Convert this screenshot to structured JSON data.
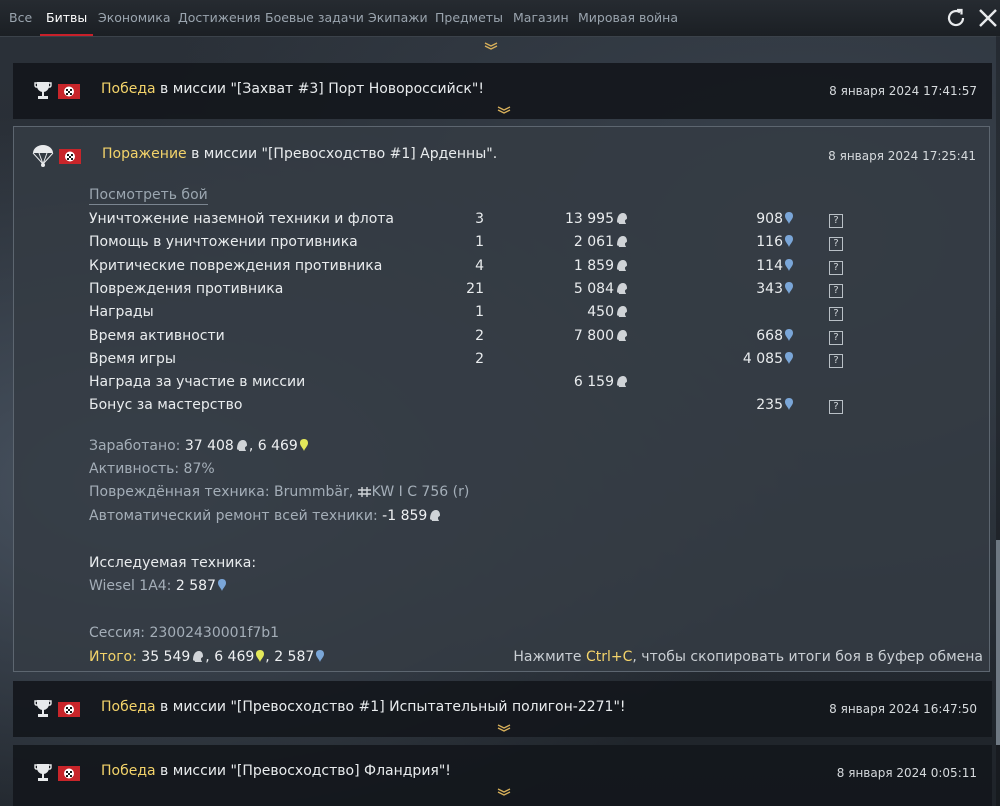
{
  "tabs": [
    {
      "label": "Все",
      "active": false
    },
    {
      "label": "Битвы",
      "active": true
    },
    {
      "label": "Экономика",
      "active": false
    },
    {
      "label": "Достижения",
      "active": false
    },
    {
      "label": "Боевые задачи",
      "active": false
    },
    {
      "label": "Экипажи",
      "active": false
    },
    {
      "label": "Предметы",
      "active": false
    },
    {
      "label": "Магазин",
      "active": false
    },
    {
      "label": "Мировая война",
      "active": false
    }
  ],
  "icons": {
    "refresh": "refresh-icon",
    "close": "close-icon",
    "victory": "trophy-icon",
    "defeat": "parachute-icon",
    "nation": "germany-flag-icon",
    "silver": "silver-lion-icon",
    "rp": "research-points-icon",
    "golden": "golden-eagle-icon",
    "help": "help-icon",
    "expand": "chevron-down-icon"
  },
  "colors": {
    "accent_tab": "#c8202a",
    "gold_text": "#f3d36a",
    "rp_blue": "#7aa6d8",
    "golden_yellow": "#e3e85a"
  },
  "missions": [
    {
      "result": "Победа",
      "text": " в миссии \"[Захват #3] Порт Новороссийск\"!",
      "date": "8 января 2024 17:41:57"
    },
    {
      "result": "Поражение",
      "text": " в миссии \"[Превосходство #1] Арденны\".",
      "date": "8 января 2024 17:25:41"
    },
    {
      "result": "Победа",
      "text": " в миссии \"[Превосходство #1] Испытательный полигон-2271\"!",
      "date": "8 января 2024 16:47:50"
    },
    {
      "result": "Победа",
      "text": " в миссии \"[Превосходство] Фландрия\"!",
      "date": "8 января 2024 0:05:11"
    }
  ],
  "details": {
    "view_battle": "Посмотреть бой",
    "help_glyph": "?",
    "rows": [
      {
        "name": "Уничтожение наземной техники и флота",
        "count": "3",
        "sl": "13 995",
        "rp": "908",
        "help": true
      },
      {
        "name": "Помощь в уничтожении противника",
        "count": "1",
        "sl": "2 061",
        "rp": "116",
        "help": true
      },
      {
        "name": "Критические повреждения противника",
        "count": "4",
        "sl": "1 859",
        "rp": "114",
        "help": true
      },
      {
        "name": "Повреждения противника",
        "count": "21",
        "sl": "5 084",
        "rp": "343",
        "help": true
      },
      {
        "name": "Награды",
        "count": "1",
        "sl": "450",
        "rp": "",
        "help": true
      },
      {
        "name": "Время активности",
        "count": "2",
        "sl": "7 800",
        "rp": "668",
        "help": true
      },
      {
        "name": "Время игры",
        "count": "2",
        "sl": "",
        "rp": "4 085",
        "help": true
      },
      {
        "name": "Награда за участие в миссии",
        "count": "",
        "sl": "6 159",
        "rp": "",
        "help": false
      },
      {
        "name": "Бонус за мастерство",
        "count": "",
        "sl": "",
        "rp": "235",
        "help": true
      }
    ],
    "earned_label": "Заработано: ",
    "earned_sl": "37 408",
    "earned_sep": ", ",
    "earned_rp": "6 469",
    "activity_label": "Активность: ",
    "activity_value": "87%",
    "damaged_label": "Повреждённая техника: ",
    "damaged_v1": "Brummbär",
    "damaged_sep": ", ",
    "damaged_v2": "KW I C 756 (r)",
    "repair_label": "Автоматический ремонт всей техники: ",
    "repair_value": "-1 859",
    "research_label": "Исследуемая техника:",
    "research_vehicle": "Wiesel 1A4: ",
    "research_value": "2 587",
    "session_label": "Сессия: ",
    "session_value": "23002430001f7b1",
    "total_label": "Итого: ",
    "total_sl": "35 549",
    "total_sep1": ", ",
    "total_rp": "6 469",
    "total_sep2": ", ",
    "total_rp2": "2 587",
    "hint_prefix": "Нажмите ",
    "hint_key": "Ctrl+C",
    "hint_suffix": ", чтобы скопировать итоги боя в буфер обмена"
  }
}
